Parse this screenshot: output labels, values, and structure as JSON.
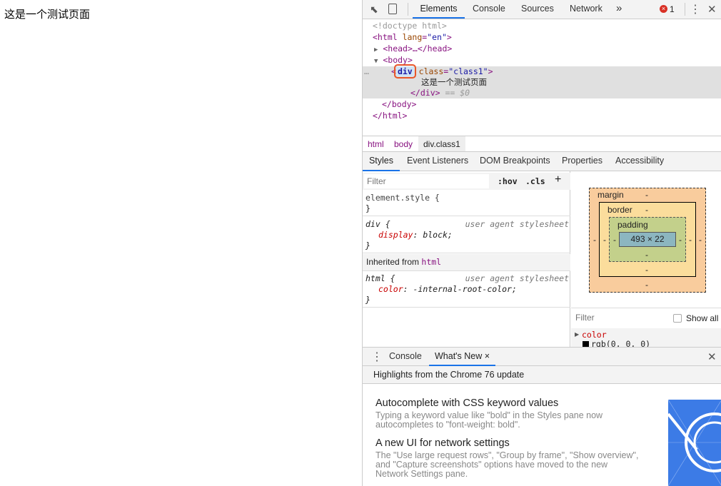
{
  "page": {
    "text": "这是一个测试页面"
  },
  "toolbar": {
    "tabs": [
      "Elements",
      "Console",
      "Sources",
      "Network"
    ],
    "more": "»",
    "error_count": "1",
    "colors": {
      "accent": "#1a73e8",
      "error": "#d93025"
    }
  },
  "tree": {
    "doctype": "<!doctype html>",
    "html_open": "<html",
    "lang_attr": "lang",
    "lang_val": "\"en\"",
    "close_angle": ">",
    "head": "<head>…</head>",
    "body_open": "<body>",
    "div": "div",
    "div_attr": "class",
    "div_val": "\"class1\"",
    "text": "这是一个测试页面",
    "div_close": "</div>",
    "eq": "== $0",
    "body_close": "</body>",
    "html_close": "</html>",
    "ellipsis": "…"
  },
  "breadcrumb": [
    "html",
    "body",
    "div.class1"
  ],
  "subtabs": [
    "Styles",
    "Event Listeners",
    "DOM Breakpoints",
    "Properties",
    "Accessibility"
  ],
  "styles": {
    "filter_placeholder": "Filter",
    "hov": ":hov",
    "cls": ".cls",
    "add": "+",
    "element_style": "element.style {",
    "close": "}",
    "div_sel": "div {",
    "ua": "user agent stylesheet",
    "div_prop": "display",
    "div_val": ": block;",
    "inherited": "Inherited from",
    "inherited_from": "html",
    "html_sel": "html {",
    "html_prop": "color",
    "html_val": ": -internal-root-color;"
  },
  "boxmodel": {
    "margin": "margin",
    "border": "border",
    "padding": "padding",
    "content": "493 × 22",
    "dash": "-"
  },
  "computed": {
    "filter_placeholder": "Filter",
    "show_all": "Show all",
    "prop": "color",
    "value": "rgb(0, 0, 0)"
  },
  "drawer": {
    "tabs": [
      "Console",
      "What's New"
    ],
    "close_tab": "×",
    "close": "✕",
    "highlights": "Highlights from the Chrome 76 update",
    "items": [
      {
        "title": "Autocomplete with CSS keyword values",
        "desc": "Typing a keyword value like \"bold\" in the Styles pane now autocompletes to \"font-weight: bold\"."
      },
      {
        "title": "A new UI for network settings",
        "desc": "The \"Use large request rows\", \"Group by frame\", \"Show overview\", and \"Capture screenshots\" options have moved to the new Network Settings pane."
      }
    ]
  }
}
